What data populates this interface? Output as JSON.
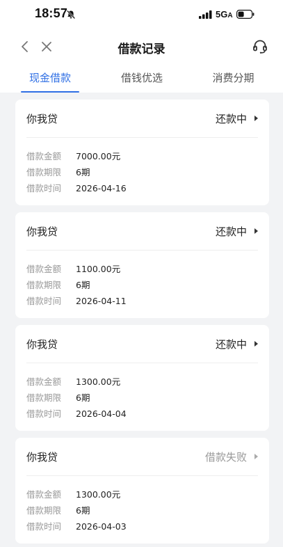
{
  "status_bar": {
    "time": "18:57",
    "network": "5G",
    "network_suffix": "A"
  },
  "header": {
    "title": "借款记录"
  },
  "tabs": [
    {
      "label": "现金借款",
      "active": true
    },
    {
      "label": "借钱优选",
      "active": false
    },
    {
      "label": "消费分期",
      "active": false
    }
  ],
  "labels": {
    "amount": "借款金额",
    "term": "借款期限",
    "date": "借款时间"
  },
  "records": [
    {
      "lender": "你我贷",
      "status": "还款中",
      "amount": "7000.00元",
      "term": "6期",
      "date": "2026-04-16",
      "failed": false
    },
    {
      "lender": "你我贷",
      "status": "还款中",
      "amount": "1100.00元",
      "term": "6期",
      "date": "2026-04-11",
      "failed": false
    },
    {
      "lender": "你我贷",
      "status": "还款中",
      "amount": "1300.00元",
      "term": "6期",
      "date": "2026-04-04",
      "failed": false
    },
    {
      "lender": "你我贷",
      "status": "借款失败",
      "amount": "1300.00元",
      "term": "6期",
      "date": "2026-04-03",
      "failed": true
    }
  ],
  "colors": {
    "accent": "#2f6fe4",
    "background": "#f2f3f5",
    "muted": "#999999"
  }
}
